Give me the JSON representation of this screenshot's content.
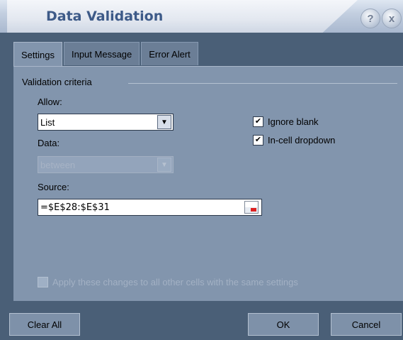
{
  "window": {
    "title": "Data Validation"
  },
  "title_buttons": {
    "help": "?",
    "close": "x"
  },
  "tabs": [
    {
      "label": "Settings",
      "active": true
    },
    {
      "label": "Input Message",
      "active": false
    },
    {
      "label": "Error Alert",
      "active": false
    }
  ],
  "settings": {
    "group_label": "Validation criteria",
    "allow_label": "Allow:",
    "allow_value": "List",
    "data_label": "Data:",
    "data_value": "between",
    "source_label": "Source:",
    "source_value": "=$E$28:$E$31",
    "ignore_blank_label": "Ignore blank",
    "ignore_blank_checked": true,
    "incell_dropdown_label": "In-cell dropdown",
    "incell_dropdown_checked": true,
    "apply_all_label": "Apply these changes to all other cells with the same settings",
    "apply_all_checked": false
  },
  "footer": {
    "clear_all": "Clear All",
    "ok": "OK",
    "cancel": "Cancel"
  },
  "icons": {
    "dropdown": "chevron-down-icon",
    "range_picker": "range-picker-icon",
    "checkmark": "check-icon"
  }
}
